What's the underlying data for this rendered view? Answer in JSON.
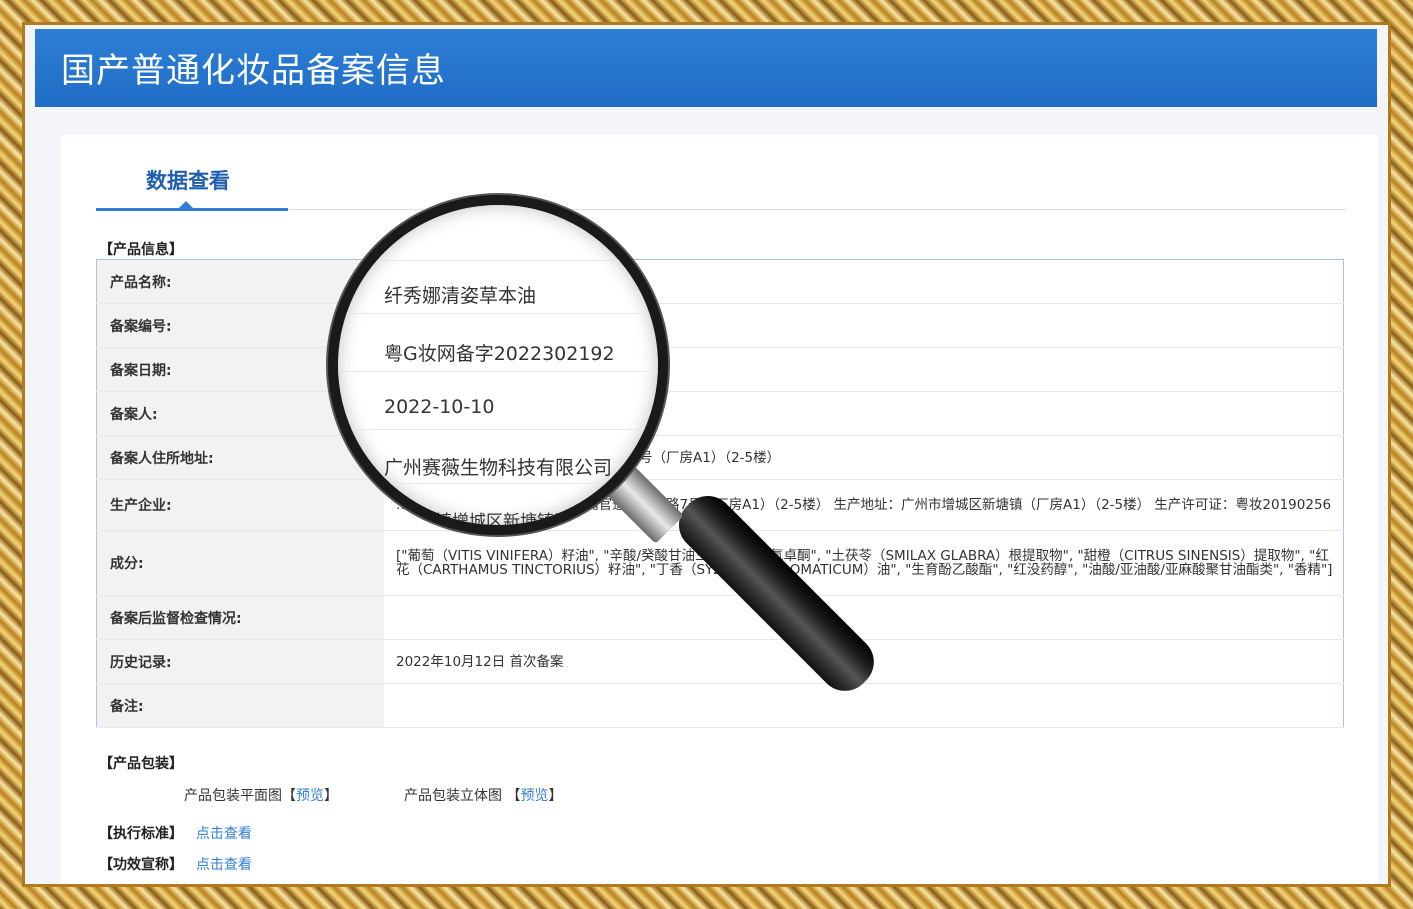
{
  "header": {
    "title": "国产普通化妆品备案信息"
  },
  "tab": {
    "label": "数据查看"
  },
  "sections": {
    "product_info": "【产品信息】",
    "packaging": "【产品包装】",
    "standard": "【执行标准】",
    "efficacy": "【功效宣称】"
  },
  "rows": [
    {
      "label": "产品名称:",
      "value": ""
    },
    {
      "label": "备案编号:",
      "value": ""
    },
    {
      "label": "备案日期:",
      "value": ""
    },
    {
      "label": "备案人:",
      "value": ""
    },
    {
      "label": "备案人住所地址:",
      "value": "号（厂房A1）（2-5楼）"
    },
    {
      "label": "生产企业:",
      "value": "…地址：广州市增城区新塘镇沙埔官道村站前路7号（厂房A1）（2-5楼） 生产地址：广州市增城区新塘镇（厂房A1）（2-5楼） 生产许可证：粤妆20190256"
    },
    {
      "label": "成分:",
      "value": "[\"葡萄（VITIS VINIFERA）籽油\", \"辛酸/癸酸甘油三酯\", \"月桂氮卓酮\", \"土茯苓（SMILAX GLABRA）根提取物\", \"甜橙（CITRUS SINENSIS）提取物\", \"红花（CARTHAMUS TINCTORIUS）籽油\", \"丁香（SYZYGIUM AROMATICUM）油\", \"生育酚乙酸酯\", \"红没药醇\", \"油酸/亚油酸/亚麻酸聚甘油酯类\", \"香精\"]"
    },
    {
      "label": "备案后监督检查情况:",
      "value": ""
    },
    {
      "label": "历史记录:",
      "value": "2022年10月12日 首次备案"
    },
    {
      "label": "备注:",
      "value": ""
    }
  ],
  "magnifier": {
    "product_name": "纤秀娜清姿草本油",
    "record_number": "粤G妆网备字2022302192",
    "record_date": "2022-10-10",
    "registrant": "广州赛薇生物科技有限公司",
    "partial_address": "区新塘镇增城区新塘镇沙"
  },
  "packaging": {
    "flat_label": "产品包装平面图",
    "solid_label": "产品包装立体图",
    "preview": "预览",
    "bracket_open": "【",
    "bracket_close": "】"
  },
  "links": {
    "view": "点击查看"
  }
}
